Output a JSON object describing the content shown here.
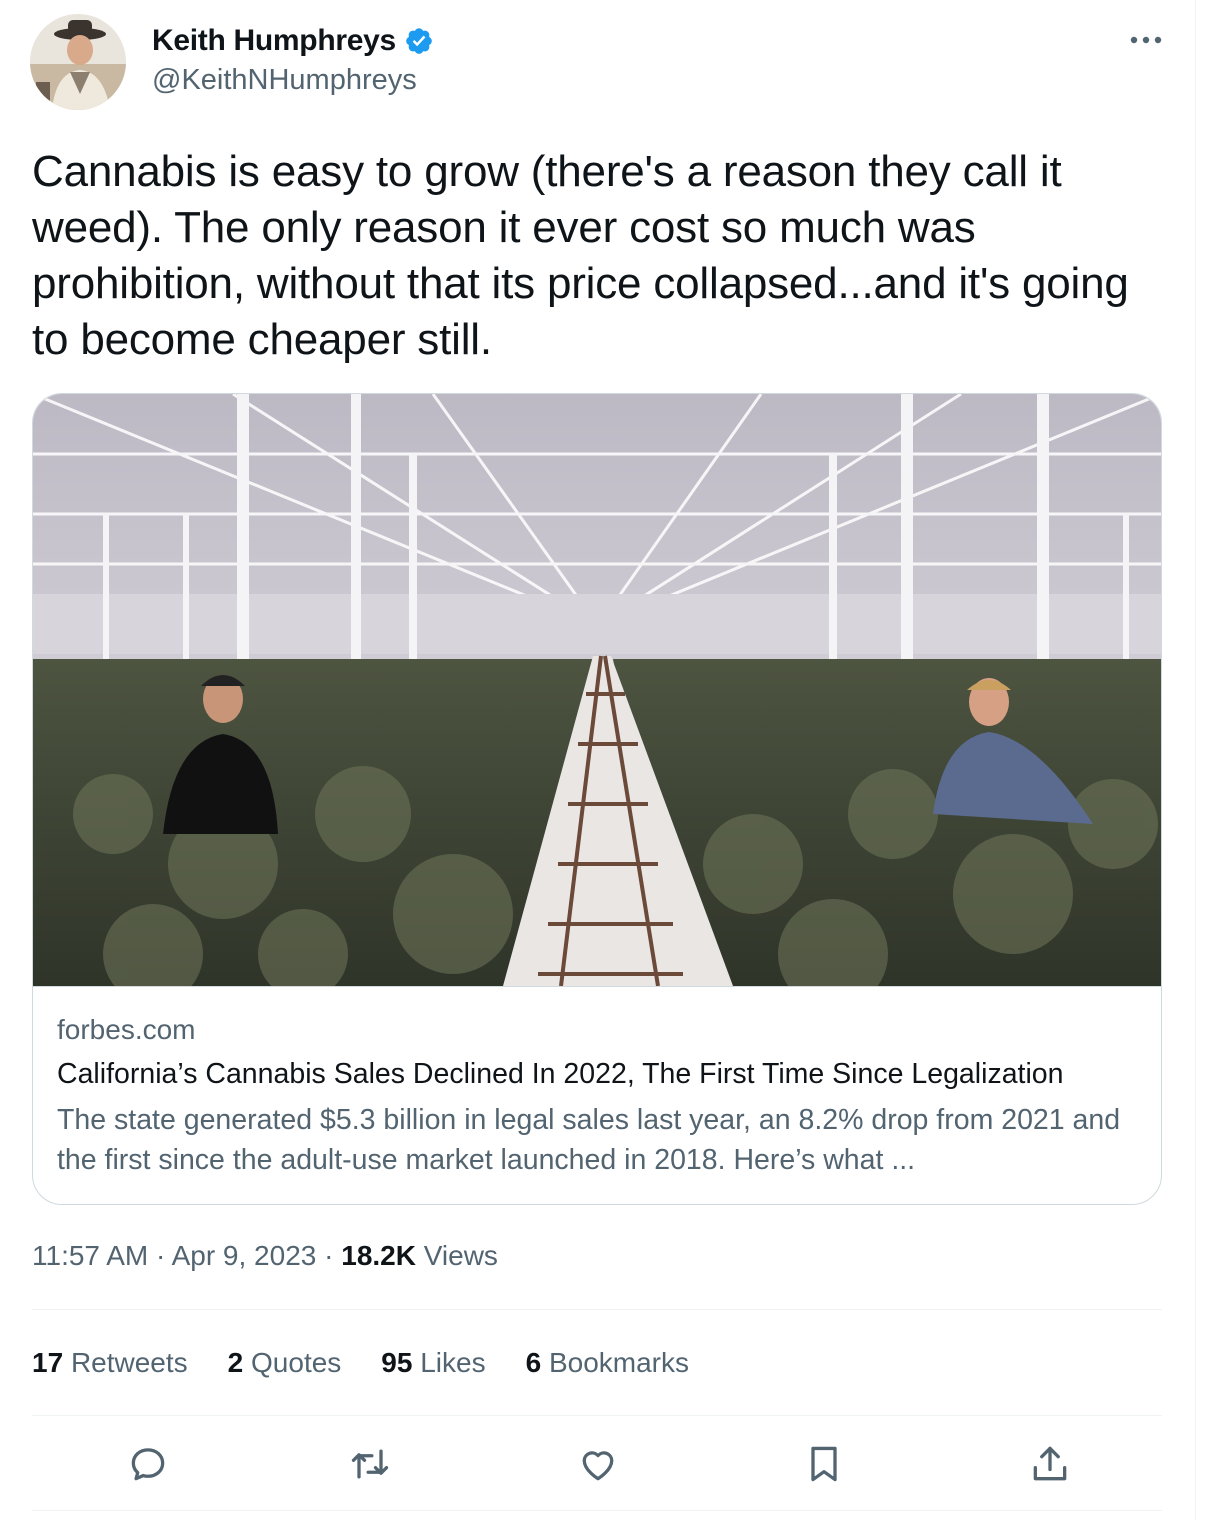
{
  "author": {
    "name": "Keith Humphreys",
    "handle": "@KeithNHumphreys",
    "verified": true
  },
  "tweet": {
    "text": "Cannabis is easy to grow (there's a reason they call it weed).  The only reason it ever cost so much was prohibition, without that its price collapsed...and it's going to become cheaper still."
  },
  "link_card": {
    "domain": "forbes.com",
    "title": "California’s Cannabis Sales Declined In 2022, The First Time Since Legalization",
    "description": "The state generated $5.3 billion in legal sales last year, an 8.2% drop from 2021 and the first since the adult-use market launched in 2018. Here’s what ..."
  },
  "meta": {
    "time": "11:57 AM",
    "separator": "·",
    "date": "Apr 9, 2023",
    "views_count": "18.2K",
    "views_label": "Views"
  },
  "stats": {
    "retweets_count": "17",
    "retweets_label": "Retweets",
    "quotes_count": "2",
    "quotes_label": "Quotes",
    "likes_count": "95",
    "likes_label": "Likes",
    "bookmarks_count": "6",
    "bookmarks_label": "Bookmarks"
  },
  "actions": [
    "reply-icon",
    "retweet-icon",
    "like-icon",
    "bookmark-icon",
    "share-icon"
  ],
  "colors": {
    "text": "#0f1419",
    "secondary": "#536471",
    "verified": "#1d9bf0",
    "border": "#cfd9de"
  }
}
